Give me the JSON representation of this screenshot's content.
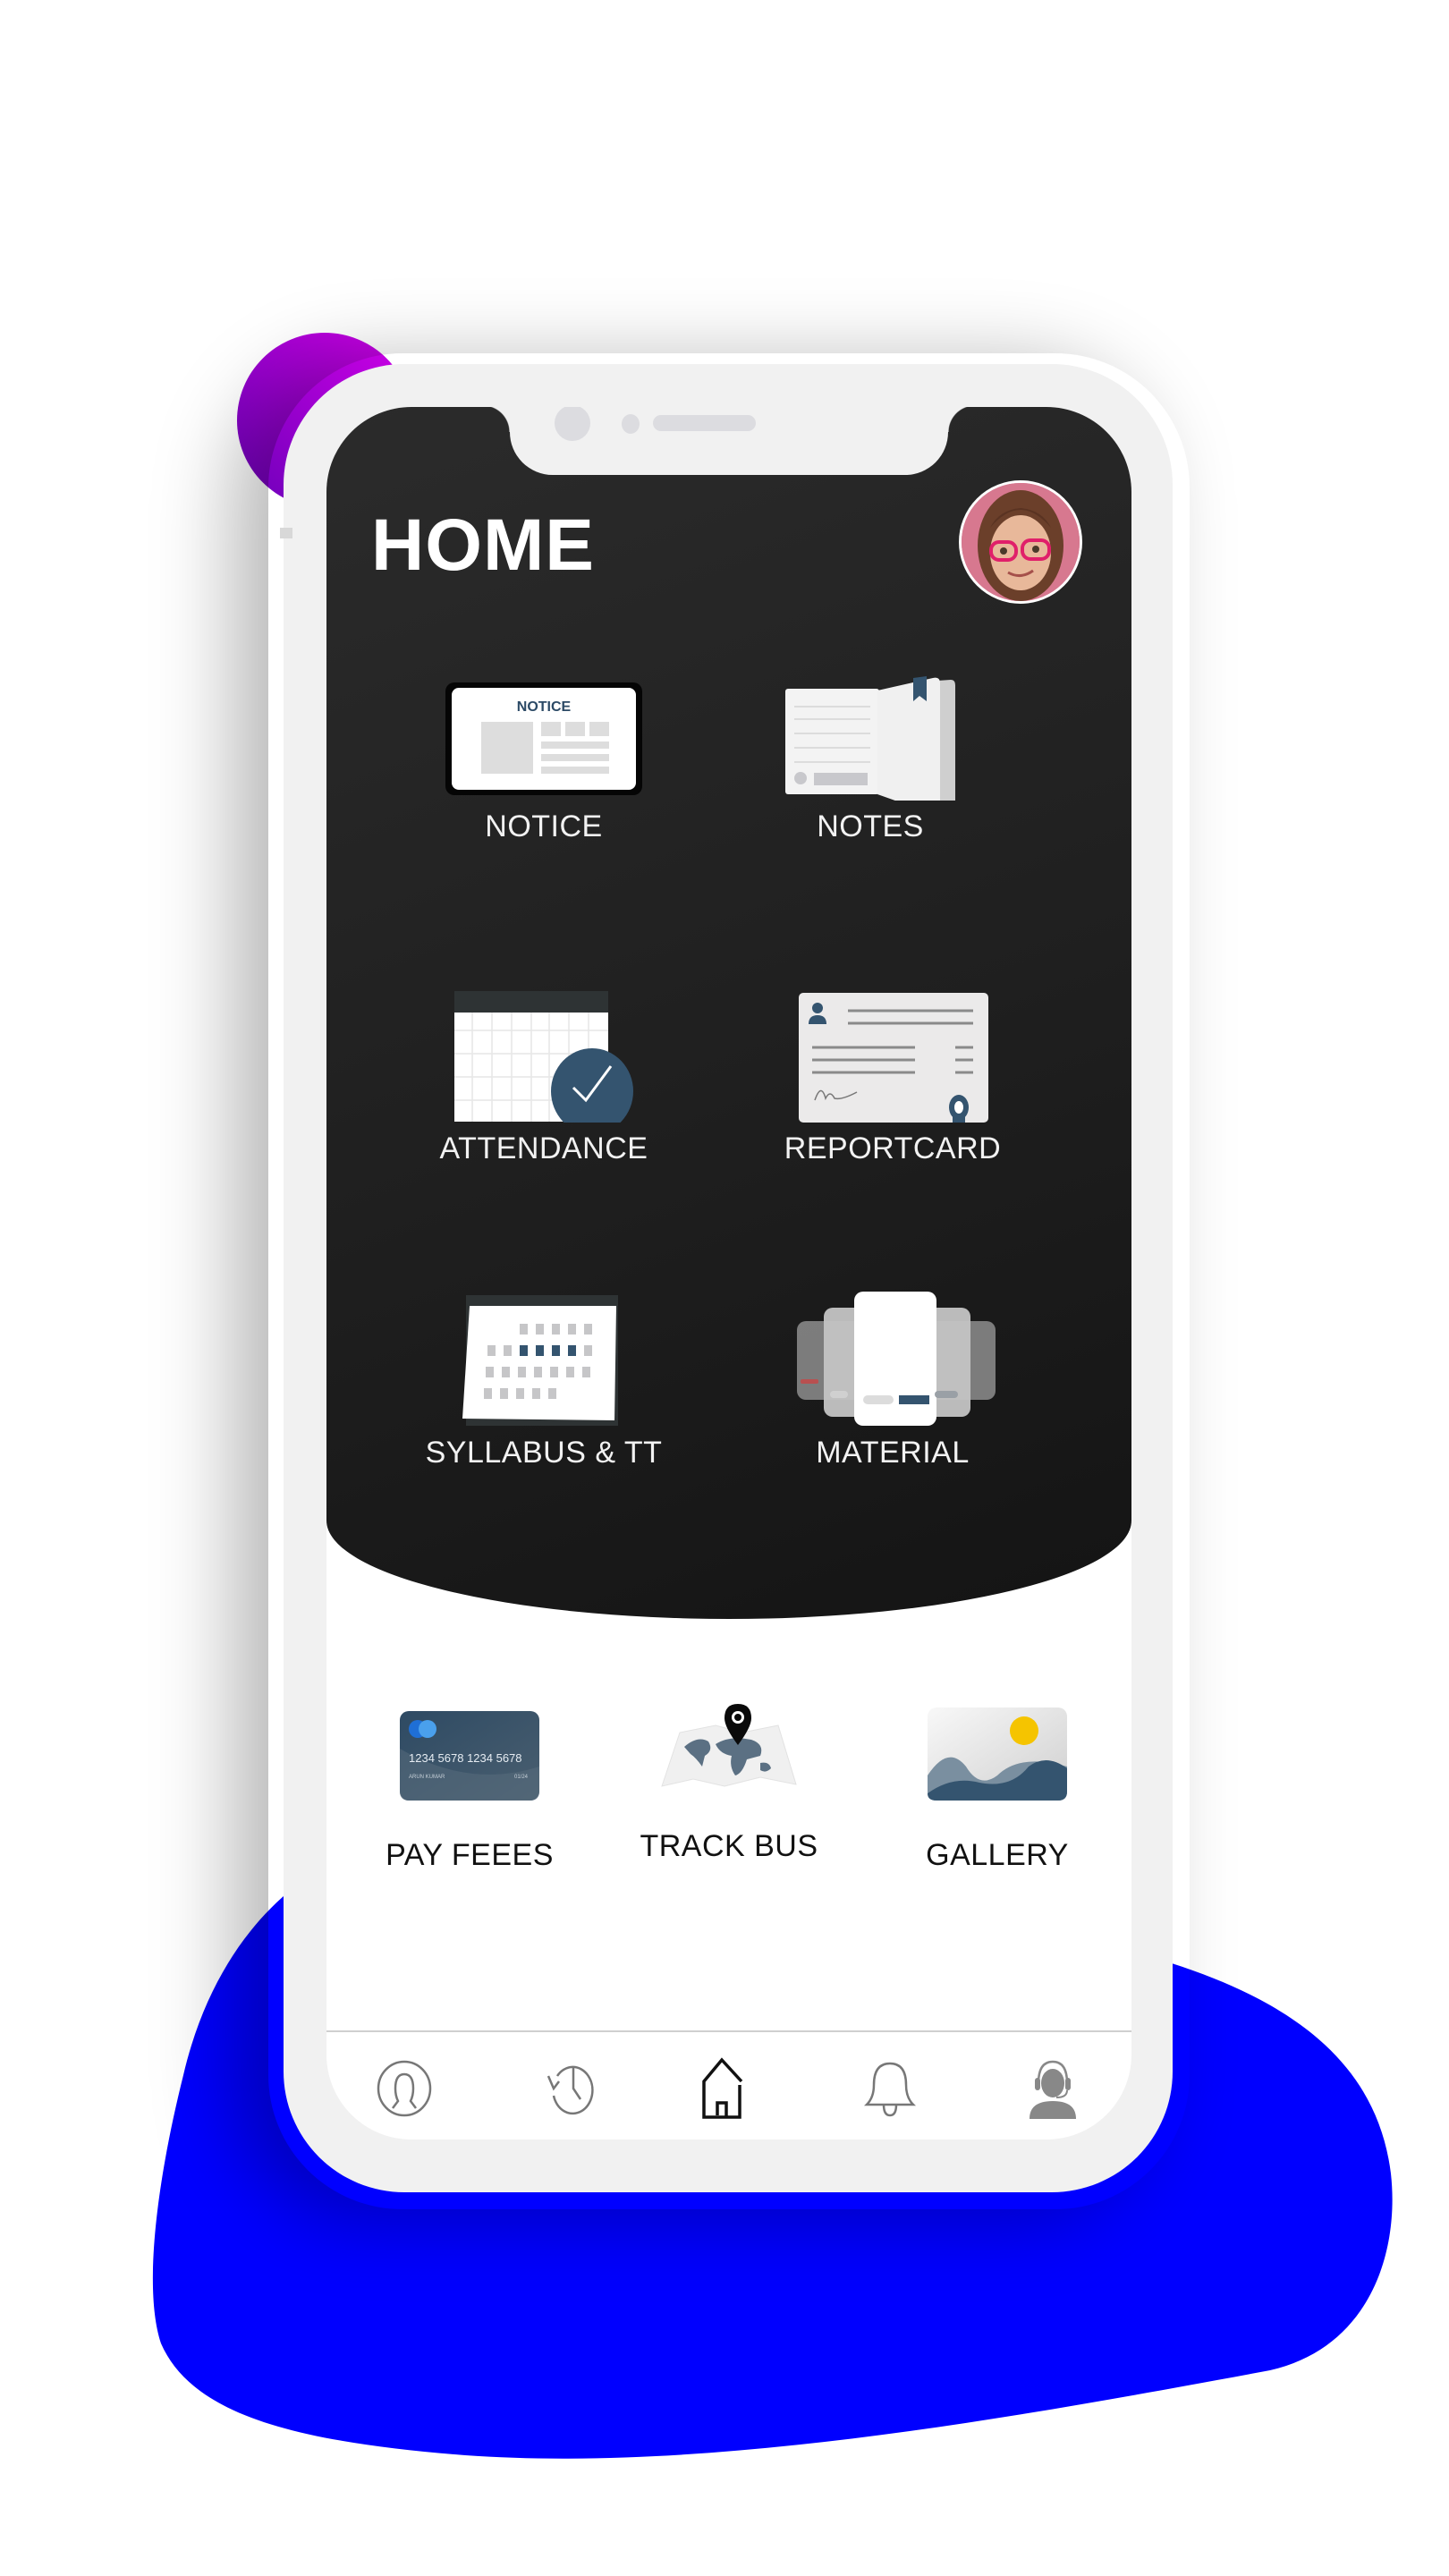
{
  "colors": {
    "blob_blue": "#0000ff",
    "blob_purple": "#a300e0",
    "accent_navy": "#34546f",
    "dark_panel": "#222222"
  },
  "header": {
    "title": "HOME",
    "avatar": "student-avatar"
  },
  "menu": [
    {
      "label": "NOTICE",
      "icon": "notice-board-icon",
      "icon_text": "NOTICE"
    },
    {
      "label": "NOTES",
      "icon": "notebook-icon"
    },
    {
      "label": "ATTENDANCE",
      "icon": "attendance-calendar-icon"
    },
    {
      "label": "REPORTCARD",
      "icon": "report-card-icon"
    },
    {
      "label": "SYLLABUS & TT",
      "icon": "timetable-calendar-icon"
    },
    {
      "label": "MATERIAL",
      "icon": "material-cards-icon"
    }
  ],
  "quick_actions": [
    {
      "label": "PAY FEEES",
      "icon": "credit-card-icon",
      "card_number": "1234 5678 1234 5678",
      "card_name": "ARUN KUMAR",
      "card_expiry": "01/24"
    },
    {
      "label": "TRACK BUS",
      "icon": "map-pin-icon"
    },
    {
      "label": "GALLERY",
      "icon": "image-gallery-icon"
    }
  ],
  "bottom_nav": [
    {
      "name": "profile",
      "icon": "profile-icon",
      "active": false
    },
    {
      "name": "history",
      "icon": "history-icon",
      "active": false
    },
    {
      "name": "home",
      "icon": "home-icon",
      "active": true
    },
    {
      "name": "notifications",
      "icon": "bell-icon",
      "active": false
    },
    {
      "name": "support",
      "icon": "support-agent-icon",
      "active": false
    }
  ]
}
